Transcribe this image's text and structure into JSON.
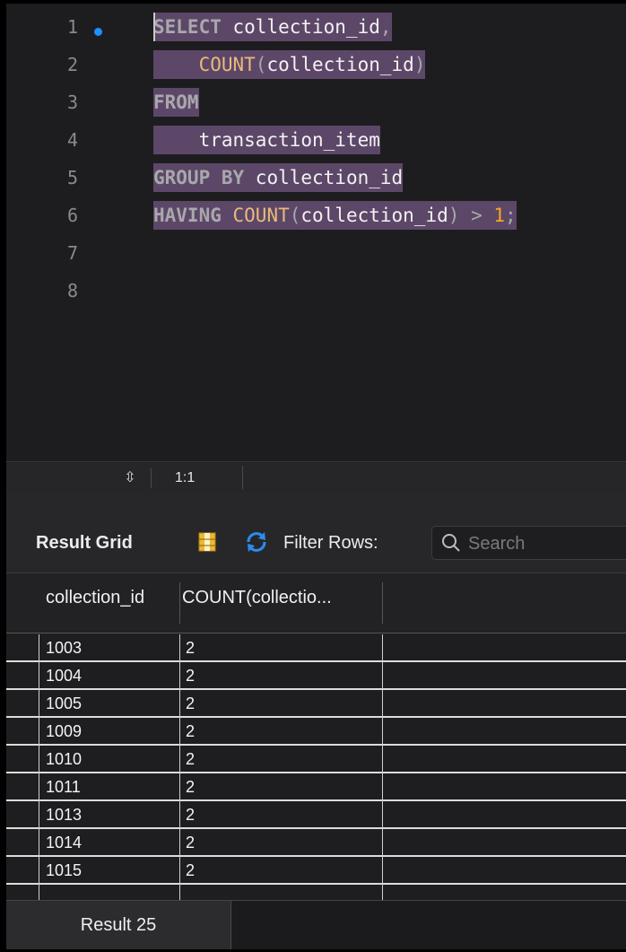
{
  "editor": {
    "line_numbers": [
      "1",
      "2",
      "3",
      "4",
      "5",
      "6",
      "7",
      "8"
    ],
    "lines": [
      {
        "segments": [
          {
            "t": "SELECT",
            "c": "kw"
          },
          {
            "t": " collection_id",
            "c": ""
          },
          {
            "t": ",",
            "c": "pun"
          }
        ]
      },
      {
        "segments": [
          {
            "t": "    ",
            "c": ""
          },
          {
            "t": "COUNT",
            "c": "fn"
          },
          {
            "t": "(",
            "c": "pun"
          },
          {
            "t": "collection_id",
            "c": ""
          },
          {
            "t": ")",
            "c": "pun"
          }
        ]
      },
      {
        "segments": [
          {
            "t": "FROM",
            "c": "kw"
          }
        ]
      },
      {
        "segments": [
          {
            "t": "    transaction_item",
            "c": ""
          }
        ]
      },
      {
        "segments": [
          {
            "t": "GROUP BY",
            "c": "kw"
          },
          {
            "t": " collection_id",
            "c": ""
          }
        ]
      },
      {
        "segments": [
          {
            "t": "HAVING",
            "c": "kw"
          },
          {
            "t": " ",
            "c": ""
          },
          {
            "t": "COUNT",
            "c": "fn"
          },
          {
            "t": "(",
            "c": "pun"
          },
          {
            "t": "collection_id",
            "c": ""
          },
          {
            "t": ")",
            "c": "pun"
          },
          {
            "t": " > ",
            "c": "pun"
          },
          {
            "t": "1",
            "c": "num-lit"
          },
          {
            "t": ";",
            "c": "pun"
          }
        ]
      }
    ]
  },
  "statusbar": {
    "stepper_glyph": "⇳",
    "cursor_position": "1:1"
  },
  "result_toolbar": {
    "title": "Result Grid",
    "filter_label": "Filter Rows:",
    "search_placeholder": "Search"
  },
  "grid": {
    "columns": [
      "collection_id",
      "COUNT(collectio..."
    ],
    "rows": [
      [
        "1003",
        "2"
      ],
      [
        "1004",
        "2"
      ],
      [
        "1005",
        "2"
      ],
      [
        "1009",
        "2"
      ],
      [
        "1010",
        "2"
      ],
      [
        "1011",
        "2"
      ],
      [
        "1013",
        "2"
      ],
      [
        "1014",
        "2"
      ],
      [
        "1015",
        "2"
      ]
    ]
  },
  "tabs": {
    "result_tab": "Result 25"
  },
  "colors": {
    "selection": "#5d4768",
    "keyword": "#a8a8ac",
    "function": "#e8b97a",
    "number": "#f5a623",
    "bookmark": "#1e90ff"
  }
}
